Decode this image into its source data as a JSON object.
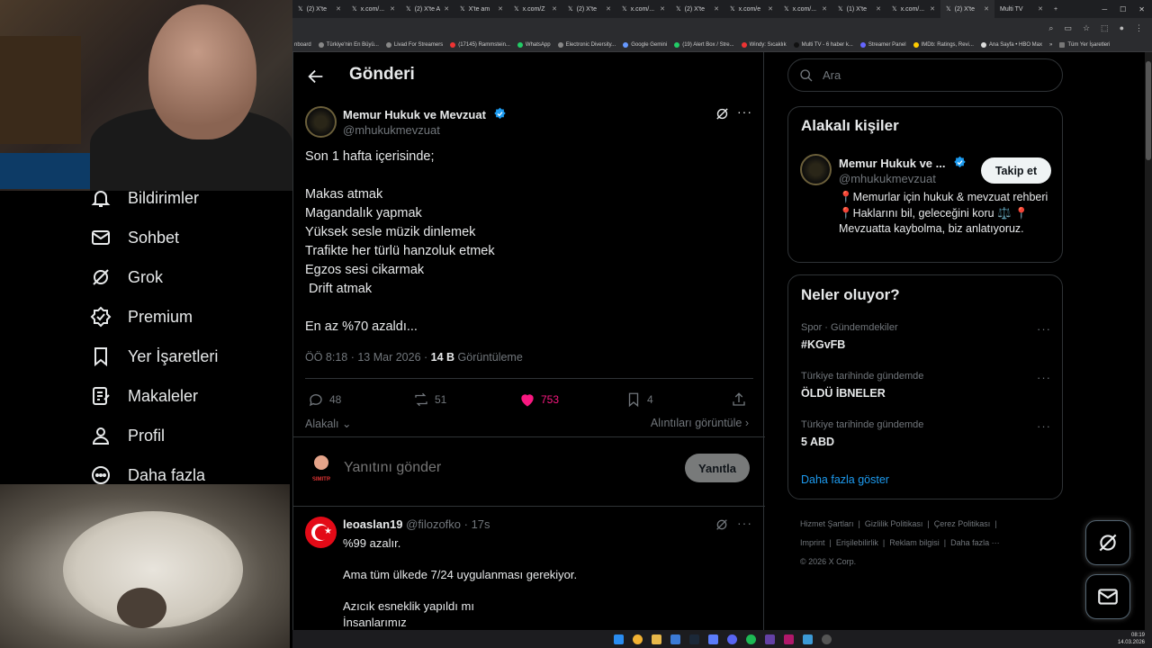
{
  "browser": {
    "tabs": [
      {
        "label": "(2) X'te"
      },
      {
        "label": "x.com/..."
      },
      {
        "label": "(2) X'te A"
      },
      {
        "label": "X'te am"
      },
      {
        "label": "x.com/Z"
      },
      {
        "label": "(2) X'te"
      },
      {
        "label": "x.com/..."
      },
      {
        "label": "(2) X'te"
      },
      {
        "label": "x.com/e"
      },
      {
        "label": "x.com/..."
      },
      {
        "label": "(1) X'te"
      },
      {
        "label": "x.com/..."
      },
      {
        "label": "(2) X'te"
      },
      {
        "label": "Multi TV"
      }
    ],
    "bookmarks": [
      "nboard",
      "Türkiye'nin En Büyü...",
      "Livad For Streamers",
      "(17145) Rammstein...",
      "WhatsApp",
      "Electronic Diversity...",
      "Google Gemini",
      "(19) Alert Box / Stre...",
      "Windy: Sıcaklık",
      "Multi TV - 6 haber k...",
      "Streamer Panel",
      "IMDb: Ratings, Revi...",
      "Ana Sayfa • HBO Max",
      "»",
      "Tüm Yer İşaretleri"
    ]
  },
  "nav": {
    "items": [
      {
        "label": "Bildirimler",
        "icon": "bell-icon"
      },
      {
        "label": "Sohbet",
        "icon": "mail-icon"
      },
      {
        "label": "Grok",
        "icon": "grok-icon"
      },
      {
        "label": "Premium",
        "icon": "verified-badge-icon"
      },
      {
        "label": "Yer İşaretleri",
        "icon": "bookmark-icon"
      },
      {
        "label": "Makaleler",
        "icon": "article-icon"
      },
      {
        "label": "Profil",
        "icon": "person-icon"
      },
      {
        "label": "Daha fazla",
        "icon": "more-circle-icon"
      }
    ]
  },
  "post": {
    "header_title": "Gönderi",
    "author_name": "Memur Hukuk ve Mevzuat",
    "author_handle": "@mhukukmevzuat",
    "text": "Son 1 hafta içerisinde;\n\nMakas atmak\nMagandalık yapmak\nYüksek sesle müzik dinlemek\nTrafikte her türlü hanzoluk etmek\nEgzos sesi cikarmak\n Drift atmak\n\nEn az %70 azaldı...",
    "time": "ÖÖ 8:18 · 13 Mar 2026 · ",
    "views_count": "14 B",
    "views_label": " Görüntüleme",
    "replies": "48",
    "reposts": "51",
    "likes": "753",
    "bookmarks": "4",
    "related_label": "Alakalı",
    "quotes_label": "Alıntıları görüntüle"
  },
  "reply_box": {
    "placeholder": "Yanıtını gönder",
    "button": "Yanıtla",
    "avatar_text": "SIMITR"
  },
  "reply": {
    "author": "leoaslan19",
    "handle": "@filozofko",
    "time": "· 17s",
    "text": "%99 azalır.\n\nAma tüm ülkede 7/24 uygulanması gerekiyor.\n\nAzıcık esneklik yapıldı mı\nİnsanlarımız"
  },
  "search": {
    "placeholder": "Ara"
  },
  "related_people": {
    "title": "Alakalı kişiler",
    "name": "Memur Hukuk ve ...",
    "handle": "@mhukukmevzuat",
    "follow": "Takip et",
    "bio": "📍Memurlar için hukuk & mevzuat rehberi 📍Haklarını bil, geleceğini koru ⚖️ 📍Mevzuatta kaybolma, biz anlatıyoruz."
  },
  "trends": {
    "title": "Neler oluyor?",
    "items": [
      {
        "category": "Spor · Gündemdekiler",
        "name": "#KGvFB"
      },
      {
        "category": "Türkiye tarihinde gündemde",
        "name": "ÖLDÜ İBNELER"
      },
      {
        "category": "Türkiye tarihinde gündemde",
        "name": "5 ABD"
      }
    ],
    "more": "Daha fazla göster"
  },
  "footer": {
    "links": [
      "Hizmet Şartları",
      "Gizlilik Politikası",
      "Çerez Politikası",
      "Imprint",
      "Erişilebilirlik",
      "Reklam bilgisi",
      "Daha fazla ···"
    ],
    "copyright": "© 2026 X Corp."
  },
  "taskbar": {
    "time": "08:19",
    "date": "14.03.2026"
  },
  "colors": {
    "like": "#f91880",
    "link": "#1d9bf0",
    "verified": "#1d9bf0",
    "bg": "#000000"
  }
}
